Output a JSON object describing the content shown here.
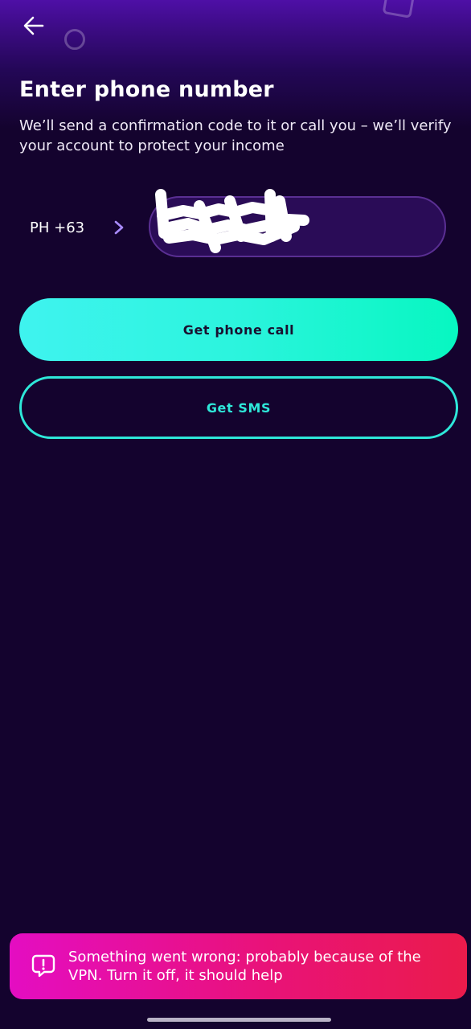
{
  "header": {
    "back_icon": "arrow-left-icon"
  },
  "main": {
    "title": "Enter phone number",
    "subtitle": "We’ll send a confirmation code to it or call you – we’ll verify your account to protect your income",
    "country_selector": {
      "code": "PH +63",
      "icon": "chevron-right-icon"
    },
    "phone_field": {
      "value": "",
      "note": "redacted"
    },
    "primary_button_label": "Get phone call",
    "secondary_button_label": "Get SMS"
  },
  "toast": {
    "icon": "alert-message-icon",
    "message": "Something went wrong: probably because of the VPN. Turn it off, it should help"
  },
  "colors": {
    "background": "#14032e",
    "accent_teal": "#2ee8d9",
    "chevron": "#a98bff",
    "toast_start": "#e40dc2",
    "toast_end": "#ea1b4b"
  }
}
